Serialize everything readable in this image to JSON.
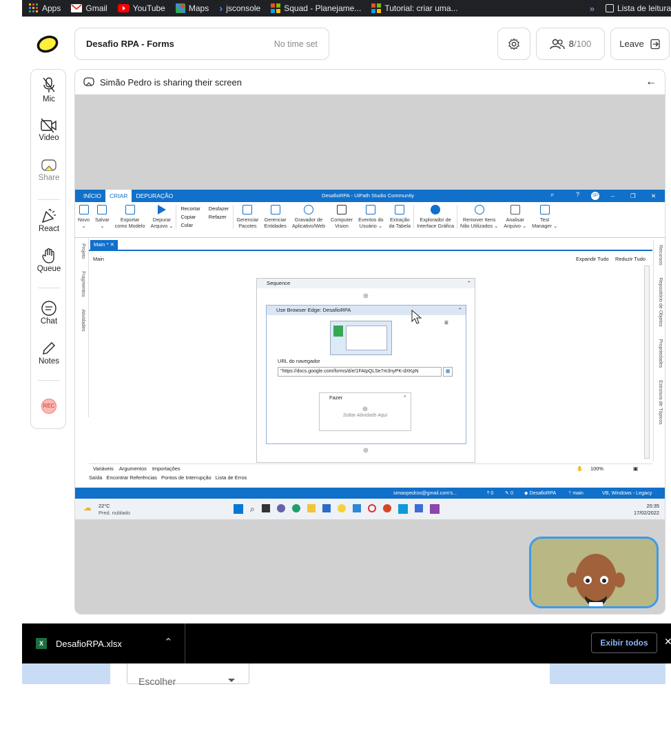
{
  "bookmarks": [
    {
      "label": "Apps",
      "icon": "apps-grid-icon",
      "color": "#fbbc05"
    },
    {
      "label": "Gmail",
      "icon": "gmail-icon",
      "color": "#ea4335"
    },
    {
      "label": "YouTube",
      "icon": "youtube-icon",
      "color": "#ff0000"
    },
    {
      "label": "Maps",
      "icon": "maps-icon",
      "color": "#34a853"
    },
    {
      "label": "jsconsole",
      "icon": "chevron-right-icon",
      "color": "#4c8bf5"
    },
    {
      "label": "Squad - Planejame...",
      "icon": "microsoft-icon",
      "color": "#f25022"
    },
    {
      "label": "Tutorial: criar uma...",
      "icon": "microsoft-icon",
      "color": "#f25022"
    }
  ],
  "bookmarks_more": "»",
  "reading_list": "Lista de leitura",
  "meeting": {
    "title": "Desafio RPA - Forms",
    "time": "No time set",
    "participants_count": "8",
    "participants_max": "/100",
    "leave_label": "Leave"
  },
  "left_tools": [
    {
      "label": "Mic",
      "icon": "mic-off-icon"
    },
    {
      "label": "Video",
      "icon": "video-off-icon"
    },
    {
      "label": "Share",
      "icon": "share-screen-icon"
    },
    {
      "label": "React",
      "icon": "party-popper-icon"
    },
    {
      "label": "Queue",
      "icon": "raise-hand-icon"
    },
    {
      "label": "Chat",
      "icon": "chat-icon"
    },
    {
      "label": "Notes",
      "icon": "pencil-icon"
    }
  ],
  "rec_label": "REC",
  "share": {
    "message": "Simão Pedro is sharing their screen"
  },
  "uipath": {
    "tabs": [
      "INÍCIO",
      "CRIAR",
      "DEPURAÇÃO"
    ],
    "active_tab": "CRIAR",
    "window_title": "DesafioRPA - UiPath Studio Community",
    "avatar": "SP",
    "ribbon": [
      {
        "label": "Novo\n⌄"
      },
      {
        "label": "Salvar\n⌄"
      },
      {
        "label": "Exportar\ncomo Modelo"
      },
      {
        "label": "Depurar\nArquivo ⌄"
      }
    ],
    "clipboard": [
      "Recortar",
      "Copiar",
      "Colar"
    ],
    "undo": [
      "Desfazer",
      "Refazer"
    ],
    "ribbon2": [
      "Gerenciar\nPacotes",
      "Gerenciar\nEntidades",
      "Gravador de\nAplicativo/Web",
      "Computer\nVision",
      "Eventos do\nUsuário ⌄",
      "Extração\nda Tabela",
      "Explorador de\nInterface Gráfica",
      "Remover Itens\nNão Utilizados ⌄",
      "Analisar\nArquivo ⌄",
      "Test\nManager ⌄"
    ],
    "doc_tab": "Main *",
    "breadcrumb": "Main",
    "expand_all": "Expandir Tudo",
    "reduce_all": "Reduzir Tudo",
    "left_panels": [
      "Projeto",
      "Fragmentos",
      "Atividades"
    ],
    "right_panels": [
      "Recursos",
      "Repositório de Objetos",
      "Propriedades",
      "Estrutura de Tópicos"
    ],
    "sequence_label": "Sequence",
    "browser_activity": "Use Browser Edge: DesafioRPA",
    "url_label": "URL do navegador",
    "url_value": "\"https://docs.google.com/forms/d/e/1FAIpQLSe7m3nyPK-dXKpN",
    "do_label": "Fazer",
    "drop_here": "Soltar Atividade Aqui",
    "bottom_tabs": [
      "Variáveis",
      "Argumentos",
      "Importações"
    ],
    "zoom": "100%",
    "output_tabs": [
      "Saída",
      "Encontrar Referências",
      "Pontos de Interrupção",
      "Lista de Erros"
    ],
    "status": {
      "user": "simaopedros@gmail.com's...",
      "uploads": "0",
      "edits": "0",
      "project": "DesafioRPA",
      "branch": "main",
      "target": "VB, Windows - Legacy"
    }
  },
  "taskbar": {
    "temp": "22°C",
    "weather": "Pred. nublado",
    "time": "20:35",
    "date": "17/02/2022"
  },
  "download": {
    "filename": "DesafioRPA.xlsx",
    "show_all": "Exibir todos"
  },
  "below": {
    "select_placeholder": "Escolher"
  }
}
